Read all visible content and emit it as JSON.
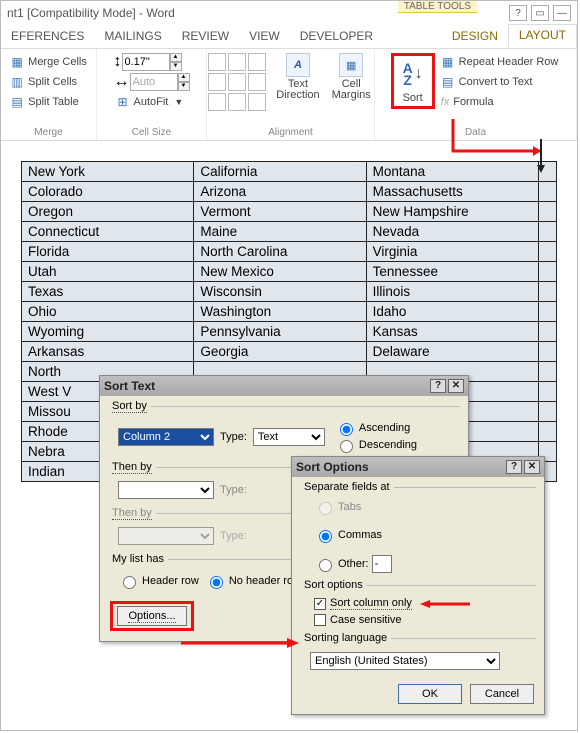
{
  "titlebar": {
    "text": "nt1 [Compatibility Mode] - Word",
    "table_tools": "TABLE TOOLS"
  },
  "tabs": {
    "references": "EFERENCES",
    "mailings": "MAILINGS",
    "review": "REVIEW",
    "view": "VIEW",
    "developer": "DEVELOPER",
    "design": "DESIGN",
    "layout": "LAYOUT"
  },
  "ribbon": {
    "merge": {
      "merge_cells": "Merge Cells",
      "split_cells": "Split Cells",
      "split_table": "Split Table",
      "group": "Merge"
    },
    "cellsize": {
      "height": "0.17\"",
      "width": "",
      "auto": "Auto",
      "autofit": "AutoFit",
      "group": "Cell Size"
    },
    "alignment": {
      "text_direction": "Text\nDirection",
      "cell_margins": "Cell\nMargins",
      "group": "Alignment"
    },
    "data": {
      "sort": "Sort",
      "repeat": "Repeat Header Row",
      "convert": "Convert to Text",
      "formula": "Formula",
      "group": "Data"
    }
  },
  "chart_data": {
    "type": "table",
    "rows": [
      [
        "New York",
        "California",
        "Montana"
      ],
      [
        "Colorado",
        "Arizona",
        "Massachusetts"
      ],
      [
        "Oregon",
        "Vermont",
        "New Hampshire"
      ],
      [
        "Connecticut",
        "Maine",
        "Nevada"
      ],
      [
        "Florida",
        "North Carolina",
        "Virginia"
      ],
      [
        "Utah",
        "New Mexico",
        "Tennessee"
      ],
      [
        "Texas",
        "Wisconsin",
        "Illinois"
      ],
      [
        "Ohio",
        "Washington",
        "Idaho"
      ],
      [
        "Wyoming",
        "Pennsylvania",
        "Kansas"
      ],
      [
        "Arkansas",
        "Georgia",
        "Delaware"
      ],
      [
        "North",
        "",
        ""
      ],
      [
        "West V",
        "",
        ""
      ],
      [
        "Missou",
        "",
        ""
      ],
      [
        "Rhode",
        "",
        ""
      ],
      [
        "Nebra",
        "",
        ""
      ],
      [
        "Indian",
        "",
        ""
      ]
    ]
  },
  "sort_dialog": {
    "title": "Sort Text",
    "sort_by": "Sort by",
    "then_by": "Then by",
    "then_by2": "Then by",
    "type": "Type:",
    "col": "Column 2",
    "type_val": "Text",
    "asc": "Ascending",
    "desc": "Descending",
    "list_has": "My list has",
    "header_row": "Header row",
    "no_header": "No header row",
    "options": "Options..."
  },
  "sort_options": {
    "title": "Sort Options",
    "separate": "Separate fields at",
    "tabs": "Tabs",
    "commas": "Commas",
    "other": "Other:",
    "other_val": "-",
    "opts": "Sort options",
    "col_only": "Sort column only",
    "case": "Case sensitive",
    "lang_label": "Sorting language",
    "lang": "English (United States)",
    "ok": "OK",
    "cancel": "Cancel"
  }
}
